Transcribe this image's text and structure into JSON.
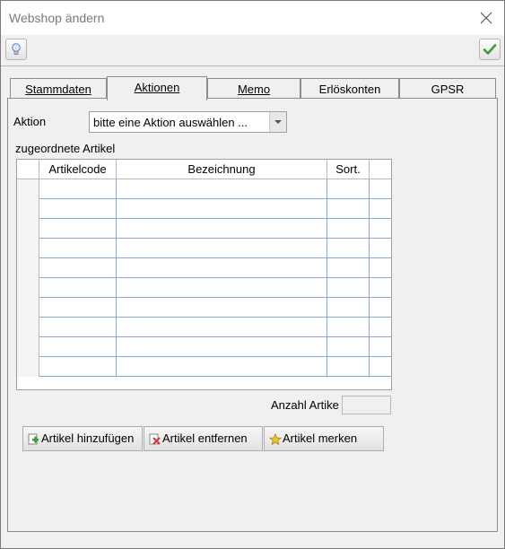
{
  "window": {
    "title": "Webshop ändern"
  },
  "toolbar": {
    "hint_icon": "lightbulb-icon",
    "ok_icon": "checkmark-icon"
  },
  "tabs": [
    {
      "label": "Stammdaten",
      "key": "S"
    },
    {
      "label": "Aktionen",
      "key": "A"
    },
    {
      "label": "Memo",
      "key": "M"
    },
    {
      "label": "Erlöskonten",
      "key": ""
    },
    {
      "label": "GPSR",
      "key": ""
    }
  ],
  "active_tab": "Aktionen",
  "aktion": {
    "label": "Aktion",
    "value": "bitte eine Aktion auswählen ..."
  },
  "articles": {
    "label": "zugeordnete Artikel",
    "columns": [
      "Artikelcode",
      "Bezeichnung",
      "Sort."
    ],
    "rows": 10
  },
  "count": {
    "label": "Anzahl Artike",
    "value": ""
  },
  "buttons": {
    "add": "Artikel hinzufügen",
    "remove": "Artikel entfernen",
    "remember": "Artikel merken"
  },
  "colors": {
    "accent_green": "#3c9a3c",
    "grid_line": "#8aa7d8"
  }
}
